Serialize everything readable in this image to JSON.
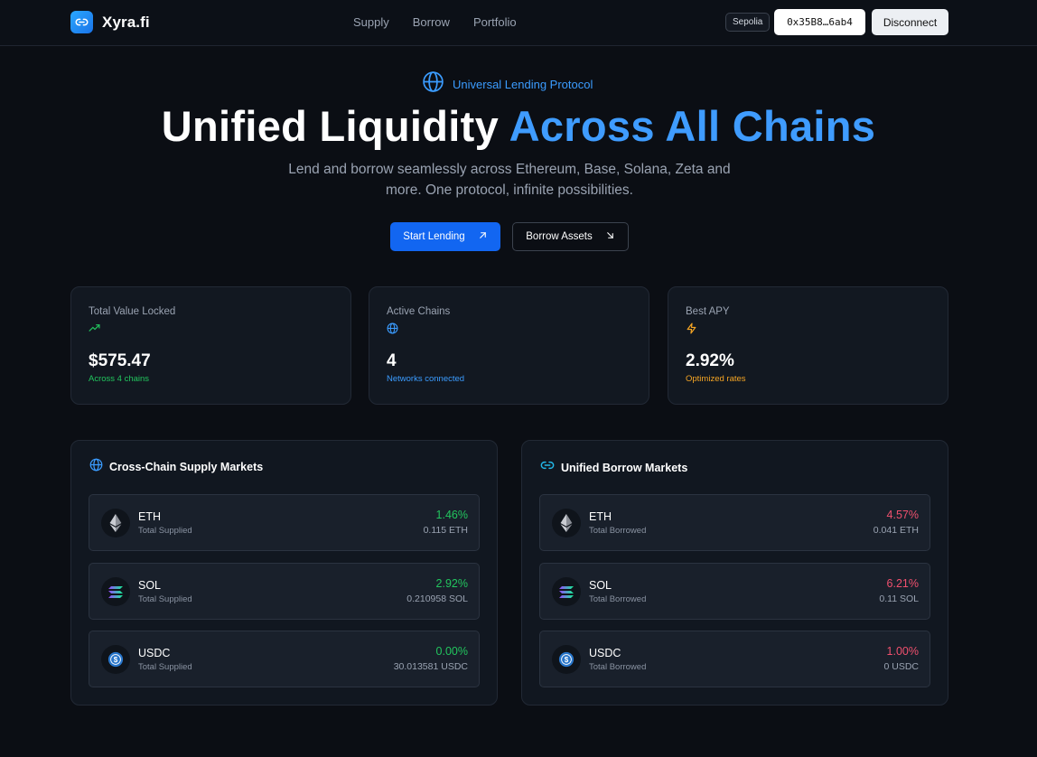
{
  "nav": {
    "brand": "Xyra.fi",
    "links": [
      "Supply",
      "Borrow",
      "Portfolio"
    ],
    "network": "Sepolia",
    "wallet": "0x35B8…6ab4",
    "disconnect": "Disconnect"
  },
  "hero": {
    "tag": "Universal Lending Protocol",
    "title_main": "Unified Liquidity ",
    "title_accent": "Across All Chains",
    "subtitle": "Lend and borrow seamlessly across Ethereum, Base, Solana, Zeta and more. One protocol, infinite possibilities.",
    "primary_cta": "Start Lending",
    "secondary_cta": "Borrow Assets"
  },
  "stats": [
    {
      "label": "Total Value Locked",
      "icon": "trending-up-icon",
      "value": "$575.47",
      "note": "Across 4 chains",
      "color": "#22c55e"
    },
    {
      "label": "Active Chains",
      "icon": "globe-icon",
      "value": "4",
      "note": "Networks connected",
      "color": "#3b9cff"
    },
    {
      "label": "Best APY",
      "icon": "lightning-icon",
      "value": "2.92%",
      "note": "Optimized rates",
      "color": "#f5a524"
    }
  ],
  "supply_markets": {
    "title": "Cross-Chain Supply Markets",
    "rows": [
      {
        "symbol": "ETH",
        "caption": "Total Supplied",
        "rate": "1.46%",
        "amount": "0.115 ETH"
      },
      {
        "symbol": "SOL",
        "caption": "Total Supplied",
        "rate": "2.92%",
        "amount": "0.210958 SOL"
      },
      {
        "symbol": "USDC",
        "caption": "Total Supplied",
        "rate": "0.00%",
        "amount": "30.013581 USDC"
      }
    ]
  },
  "borrow_markets": {
    "title": "Unified Borrow Markets",
    "rows": [
      {
        "symbol": "ETH",
        "caption": "Total Borrowed",
        "rate": "4.57%",
        "amount": "0.041 ETH"
      },
      {
        "symbol": "SOL",
        "caption": "Total Borrowed",
        "rate": "6.21%",
        "amount": "0.11 SOL"
      },
      {
        "symbol": "USDC",
        "caption": "Total Borrowed",
        "rate": "1.00%",
        "amount": "0 USDC"
      }
    ]
  },
  "colors": {
    "accent": "#3f9cff",
    "primary_button": "#1266f1",
    "supply_rate": "#22c55e",
    "borrow_rate": "#f0506e"
  }
}
